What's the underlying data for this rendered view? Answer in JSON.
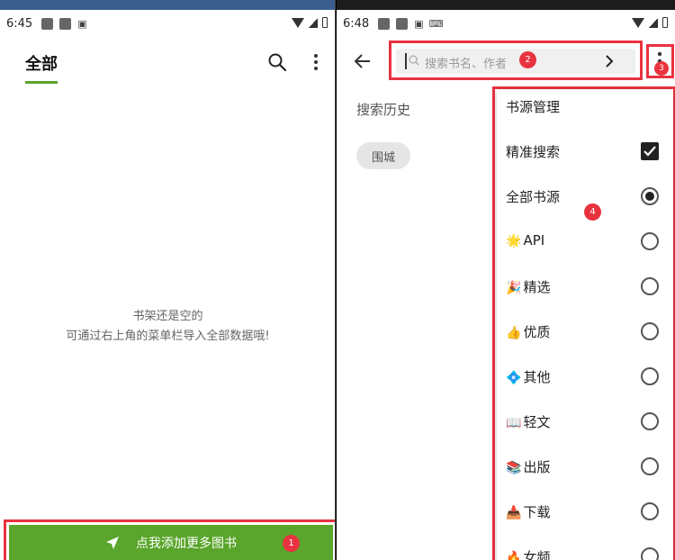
{
  "left_phone": {
    "status": {
      "time": "6:45"
    },
    "tab_all": "全部",
    "empty_line1": "书架还是空的",
    "empty_line2": "可通过右上角的菜单栏导入全部数据哦!",
    "add_button_label": "点我添加更多图书",
    "badge1": "1"
  },
  "right_phone": {
    "status": {
      "time": "6:48"
    },
    "search_placeholder": "搜索书名、作者",
    "badge2": "2",
    "badge3": "3",
    "badge4": "4",
    "history_title": "搜索历史",
    "history_chip": "围城",
    "menu": {
      "source_manage": "书源管理",
      "precise_search": "精准搜索",
      "precise_checked": true,
      "all_sources": "全部书源",
      "groups": [
        {
          "emoji": "🌟",
          "label": "API"
        },
        {
          "emoji": "🎉",
          "label": "精选"
        },
        {
          "emoji": "👍",
          "label": "优质"
        },
        {
          "emoji": "💠",
          "label": "其他"
        },
        {
          "emoji": "📖",
          "label": "轻文"
        },
        {
          "emoji": "📚",
          "label": "出版"
        },
        {
          "emoji": "📥",
          "label": "下载"
        },
        {
          "emoji": "🔥",
          "label": "女频"
        }
      ]
    }
  },
  "colors": {
    "accent_green": "#5aa52b",
    "annotation_red": "#e8333f"
  }
}
